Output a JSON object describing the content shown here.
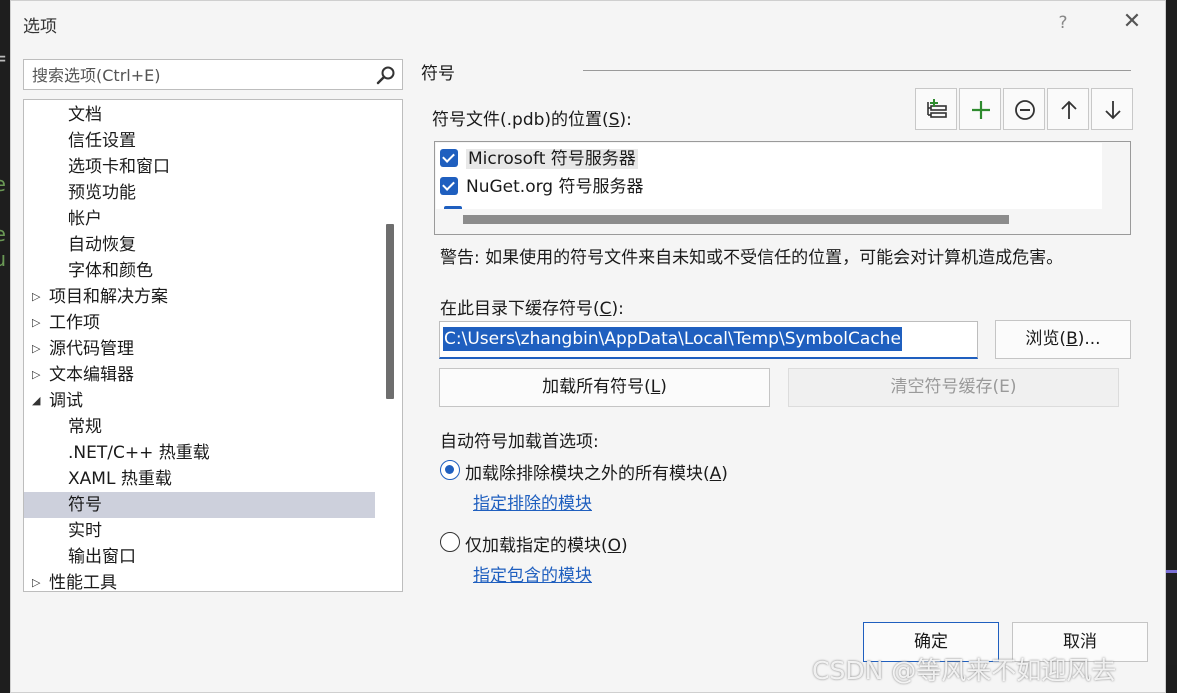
{
  "dialog": {
    "title": "选项",
    "help": "?",
    "close": "✕"
  },
  "search": {
    "placeholder": "搜索选项(Ctrl+E)"
  },
  "tree": {
    "items": [
      {
        "label": "文档"
      },
      {
        "label": "信任设置"
      },
      {
        "label": "选项卡和窗口"
      },
      {
        "label": "预览功能"
      },
      {
        "label": "帐户"
      },
      {
        "label": "自动恢复"
      },
      {
        "label": "字体和颜色"
      },
      {
        "label": "项目和解决方案",
        "arrow": "▷"
      },
      {
        "label": "工作项",
        "arrow": "▷"
      },
      {
        "label": "源代码管理",
        "arrow": "▷"
      },
      {
        "label": "文本编辑器",
        "arrow": "▷"
      },
      {
        "label": "调试",
        "arrow": "◢"
      },
      {
        "label": "常规"
      },
      {
        "label": ".NET/C++ 热重载"
      },
      {
        "label": "XAML 热重载"
      },
      {
        "label": "符号",
        "selected": true
      },
      {
        "label": "实时"
      },
      {
        "label": "输出窗口"
      },
      {
        "label": "性能工具",
        "arrow": "▷"
      }
    ]
  },
  "panel": {
    "section_title": "符号",
    "locations_label": "符号文件(.pdb)的位置(",
    "locations_key": "S",
    "locations_suffix": "):",
    "locations": [
      {
        "label": "Microsoft 符号服务器",
        "checked": true
      },
      {
        "label": "NuGet.org 符号服务器",
        "checked": true
      }
    ],
    "warning": "警告: 如果使用的符号文件来自未知或不受信任的位置，可能会对计算机造成危害。",
    "cache_label": "在此目录下缓存符号(",
    "cache_key": "C",
    "cache_suffix": "):",
    "cache_path": "C:\\Users\\zhangbin\\AppData\\Local\\Temp\\SymbolCache",
    "browse_pre": "浏览(",
    "browse_key": "B",
    "browse_post": ")...",
    "load_all_pre": "加载所有符号(",
    "load_all_key": "L",
    "load_all_post": ")",
    "clear_cache": "清空符号缓存(E)",
    "auto_load_label": "自动符号加载首选项:",
    "option_all_pre": "加载除排除模块之外的所有模块(",
    "option_all_key": "A",
    "option_all_post": ")",
    "link_excluded": "指定排除的模块",
    "option_only_pre": "仅加载指定的模块(",
    "option_only_key": "O",
    "option_only_post": ")",
    "link_included": "指定包含的模块"
  },
  "footer": {
    "ok": "确定",
    "cancel": "取消"
  },
  "watermark": "CSDN @等风来不如迎风去",
  "colors": {
    "accent": "#1f5fbf",
    "selection": "#cdd0dc",
    "add_icon": "#2e8b2e"
  }
}
